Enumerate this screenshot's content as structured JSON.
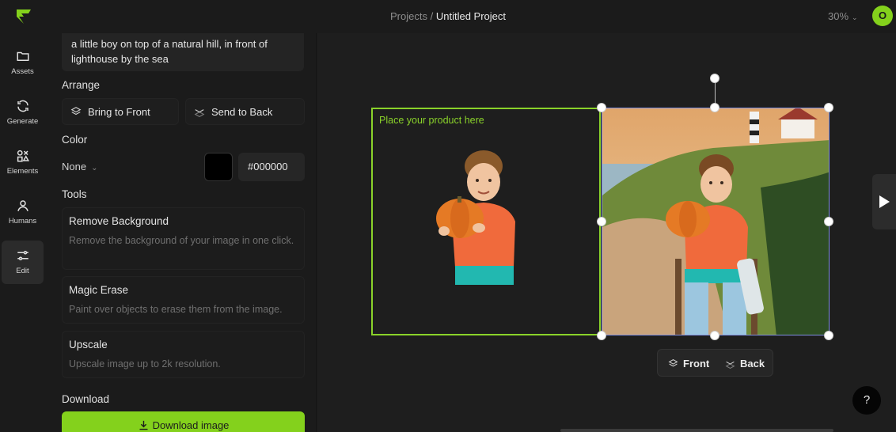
{
  "header": {
    "breadcrumb_root": "Projects",
    "breadcrumb_sep": "/",
    "project_name": "Untitled Project",
    "zoom": "30%",
    "avatar_initial": "O"
  },
  "rail": {
    "items": [
      {
        "label": "Assets",
        "icon": "folder-icon"
      },
      {
        "label": "Generate",
        "icon": "refresh-icon"
      },
      {
        "label": "Elements",
        "icon": "shapes-icon"
      },
      {
        "label": "Humans",
        "icon": "person-icon"
      },
      {
        "label": "Edit",
        "icon": "sliders-icon",
        "active": true
      }
    ]
  },
  "panel": {
    "prompt": "a little boy on top of a natural hill, in front of lighthouse by the sea",
    "arrange_title": "Arrange",
    "bring_front": "Bring to Front",
    "send_back": "Send to Back",
    "color_title": "Color",
    "color_none": "None",
    "color_hex": "#000000",
    "tools_title": "Tools",
    "tools": [
      {
        "title": "Remove Background",
        "desc": "Remove the background of your image in one click."
      },
      {
        "title": "Magic Erase",
        "desc": "Paint over objects to erase them from the image."
      },
      {
        "title": "Upscale",
        "desc": "Upscale image up to 2k resolution."
      }
    ],
    "download_title": "Download",
    "download_button": "Download image"
  },
  "canvas": {
    "placeholder_label": "Place your product here",
    "front_label": "Front",
    "back_label": "Back",
    "help_label": "?"
  },
  "colors": {
    "accent": "#84d11c",
    "background": "#1b1b1b",
    "selection_border": "#7f8ee0"
  }
}
